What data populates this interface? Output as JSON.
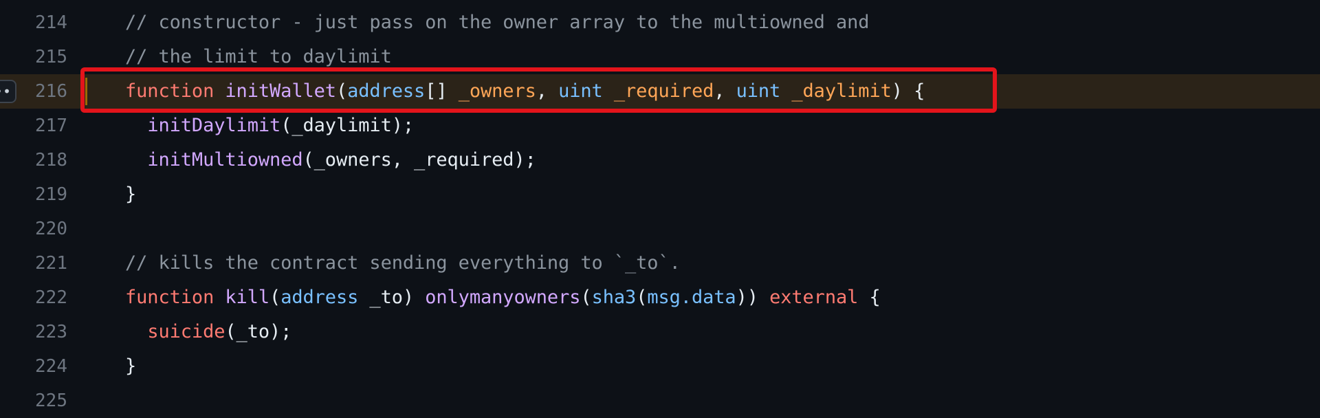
{
  "editor": {
    "highlighted_line": 216,
    "line_actions_label": "••",
    "lines": [
      {
        "number": "214",
        "tokens": [
          {
            "t": "cm",
            "v": "// constructor - just pass on the owner array to the multiowned and"
          }
        ]
      },
      {
        "number": "215",
        "tokens": [
          {
            "t": "cm",
            "v": "// the limit to daylimit"
          }
        ]
      },
      {
        "number": "216",
        "tokens": [
          {
            "t": "kw",
            "v": "function"
          },
          {
            "t": "pl",
            "v": " "
          },
          {
            "t": "fn",
            "v": "initWallet"
          },
          {
            "t": "pl",
            "v": "("
          },
          {
            "t": "ty",
            "v": "address"
          },
          {
            "t": "pl",
            "v": "[] "
          },
          {
            "t": "pr",
            "v": "_owners"
          },
          {
            "t": "pl",
            "v": ", "
          },
          {
            "t": "ty",
            "v": "uint"
          },
          {
            "t": "pl",
            "v": " "
          },
          {
            "t": "pr",
            "v": "_required"
          },
          {
            "t": "pl",
            "v": ", "
          },
          {
            "t": "ty",
            "v": "uint"
          },
          {
            "t": "pl",
            "v": " "
          },
          {
            "t": "pr",
            "v": "_daylimit"
          },
          {
            "t": "pl",
            "v": ") {"
          }
        ]
      },
      {
        "number": "217",
        "tokens": [
          {
            "t": "pl",
            "v": "  "
          },
          {
            "t": "fn",
            "v": "initDaylimit"
          },
          {
            "t": "pl",
            "v": "(_daylimit);"
          }
        ]
      },
      {
        "number": "218",
        "tokens": [
          {
            "t": "pl",
            "v": "  "
          },
          {
            "t": "fn",
            "v": "initMultiowned"
          },
          {
            "t": "pl",
            "v": "(_owners, _required);"
          }
        ]
      },
      {
        "number": "219",
        "tokens": [
          {
            "t": "pl",
            "v": "}"
          }
        ]
      },
      {
        "number": "220",
        "tokens": []
      },
      {
        "number": "221",
        "tokens": [
          {
            "t": "cm",
            "v": "// kills the contract sending everything to `_to`."
          }
        ]
      },
      {
        "number": "222",
        "tokens": [
          {
            "t": "kw",
            "v": "function"
          },
          {
            "t": "pl",
            "v": " "
          },
          {
            "t": "fn",
            "v": "kill"
          },
          {
            "t": "pl",
            "v": "("
          },
          {
            "t": "ty",
            "v": "address"
          },
          {
            "t": "pl",
            "v": " _to) "
          },
          {
            "t": "fn",
            "v": "onlymanyowners"
          },
          {
            "t": "pl",
            "v": "("
          },
          {
            "t": "ty",
            "v": "sha3"
          },
          {
            "t": "pl",
            "v": "("
          },
          {
            "t": "ty",
            "v": "msg.data"
          },
          {
            "t": "pl",
            "v": ")) "
          },
          {
            "t": "kw",
            "v": "external"
          },
          {
            "t": "pl",
            "v": " {"
          }
        ]
      },
      {
        "number": "223",
        "tokens": [
          {
            "t": "pl",
            "v": "  "
          },
          {
            "t": "kw",
            "v": "suicide"
          },
          {
            "t": "pl",
            "v": "(_to);"
          }
        ]
      },
      {
        "number": "224",
        "tokens": [
          {
            "t": "pl",
            "v": "}"
          }
        ]
      },
      {
        "number": "225",
        "tokens": []
      }
    ]
  },
  "colors": {
    "background": "#0d1117",
    "highlight_line": "#2b2318",
    "annotation_box": "#e3141b"
  }
}
